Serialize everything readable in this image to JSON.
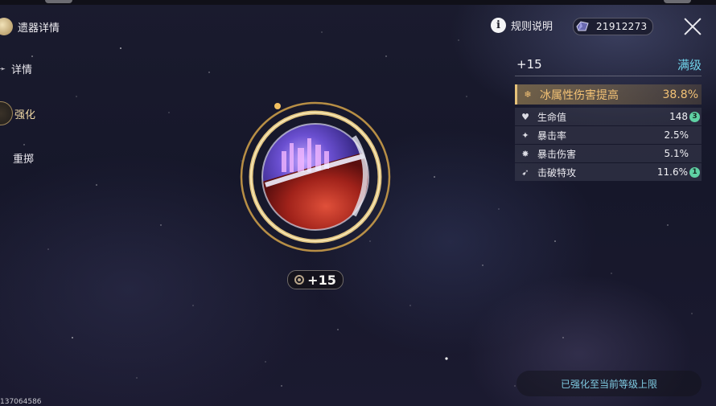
{
  "header": {
    "title": "遗器详情",
    "icon": "relic-emblem-icon"
  },
  "nav": {
    "items": [
      {
        "label": "详情",
        "icon": "arrow-icon",
        "active": false
      },
      {
        "label": "强化",
        "icon": "relic-medal-icon",
        "active": true
      },
      {
        "label": "重掷",
        "icon": "none",
        "active": false
      }
    ]
  },
  "topbar": {
    "rules_label": "规则说明",
    "currency_value": "21912273",
    "currency_icon": "gem-icon"
  },
  "relic": {
    "level": "+15"
  },
  "stats": {
    "level": "+15",
    "max_label": "满级",
    "main": {
      "name": "冰属性伤害提高",
      "value": "38.8%",
      "icon": "ice-icon"
    },
    "subs": [
      {
        "name": "生命值",
        "value": "148",
        "bump": "3",
        "icon": "heart-icon"
      },
      {
        "name": "暴击率",
        "value": "2.5%",
        "bump": "",
        "icon": "crit-rate-icon"
      },
      {
        "name": "暴击伤害",
        "value": "5.1%",
        "bump": "",
        "icon": "crit-dmg-icon"
      },
      {
        "name": "击破特攻",
        "value": "11.6%",
        "bump": "1",
        "icon": "break-icon"
      }
    ]
  },
  "notice": "已强化至当前等级上限",
  "uid": "137064586",
  "colors": {
    "accent_gold": "#f3c275",
    "max_cyan": "#6fd1e8",
    "bump_green": "#5fd1a4"
  }
}
